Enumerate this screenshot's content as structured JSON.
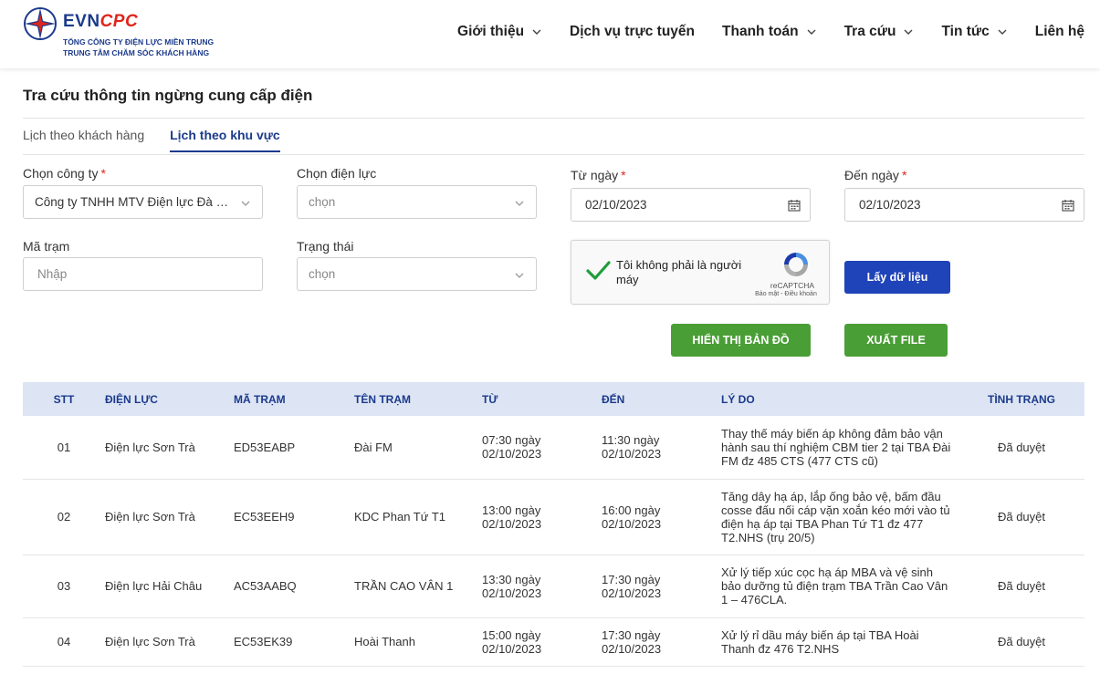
{
  "header": {
    "brand_evn": "EVN",
    "brand_cpc": "CPC",
    "line1": "TỔNG CÔNG TY ĐIỆN LỰC MIỀN TRUNG",
    "line2": "TRUNG TÂM CHĂM SÓC KHÁCH HÀNG",
    "nav": [
      {
        "label": "Giới thiệu",
        "has_dropdown": true
      },
      {
        "label": "Dịch vụ trực tuyến",
        "has_dropdown": false
      },
      {
        "label": "Thanh toán",
        "has_dropdown": true
      },
      {
        "label": "Tra cứu",
        "has_dropdown": true
      },
      {
        "label": "Tin tức",
        "has_dropdown": true
      },
      {
        "label": "Liên hệ",
        "has_dropdown": false
      }
    ]
  },
  "page": {
    "title": "Tra cứu thông tin ngừng cung cấp điện",
    "tabs": [
      {
        "label": "Lịch theo khách hàng",
        "active": false
      },
      {
        "label": "Lịch theo khu vực",
        "active": true
      }
    ]
  },
  "form": {
    "company_label": "Chọn công ty",
    "company_value": "Công ty TNHH MTV Điện lực Đà Nẵng",
    "power_label": "Chọn điện lực",
    "power_placeholder": "chọn",
    "from_label": "Từ ngày",
    "from_value": "02/10/2023",
    "to_label": "Đến ngày",
    "to_value": "02/10/2023",
    "station_label": "Mã trạm",
    "station_placeholder": "Nhập",
    "status_label": "Trạng thái",
    "status_placeholder": "chọn",
    "required_mark": "*"
  },
  "captcha": {
    "text": "Tôi không phải là người máy",
    "brand": "reCAPTCHA",
    "links": "Bảo mật - Điều khoản"
  },
  "buttons": {
    "fetch": "Lấy dữ liệu",
    "map": "HIỂN THỊ BẢN ĐỒ",
    "export": "XUẤT FILE"
  },
  "colors": {
    "primary": "#1b3a8c",
    "button_blue": "#1f43b8",
    "button_green": "#4a9e36",
    "required": "#e0241b",
    "table_header_bg": "#dde5f4"
  },
  "table": {
    "headers": [
      "STT",
      "ĐIỆN LỰC",
      "MÃ TRẠM",
      "TÊN TRẠM",
      "TỪ",
      "ĐẾN",
      "LÝ DO",
      "TÌNH TRẠNG"
    ],
    "rows": [
      {
        "stt": "01",
        "dien_luc": "Điện lực Sơn Trà",
        "ma_tram": "ED53EABP",
        "ten_tram": "Đài FM",
        "tu": "07:30 ngày 02/10/2023",
        "den": "11:30 ngày 02/10/2023",
        "ly_do": "Thay thế máy biến áp không đảm bảo vận hành sau thí nghiệm CBM tier 2 tại TBA Đài FM đz 485 CTS (477 CTS cũ)",
        "tinh_trang": "Đã duyệt"
      },
      {
        "stt": "02",
        "dien_luc": "Điện lực Sơn Trà",
        "ma_tram": "EC53EEH9",
        "ten_tram": "KDC Phan Tứ T1",
        "tu": "13:00 ngày 02/10/2023",
        "den": "16:00 ngày 02/10/2023",
        "ly_do": "Tăng dây hạ áp, lắp ống bảo vệ, bấm đầu cosse đấu nối cáp vặn xoắn kéo mới vào tủ điện hạ áp tại TBA Phan Tứ T1 đz 477 T2.NHS (trụ 20/5)",
        "tinh_trang": "Đã duyệt"
      },
      {
        "stt": "03",
        "dien_luc": "Điện lực Hải Châu",
        "ma_tram": "AC53AABQ",
        "ten_tram": "TRẦN CAO VÂN 1",
        "tu": "13:30 ngày 02/10/2023",
        "den": "17:30 ngày 02/10/2023",
        "ly_do": "Xử lý tiếp xúc cọc hạ áp MBA và vệ sinh bảo dưỡng tủ điện trạm TBA Trần Cao Vân 1 – 476CLA.",
        "tinh_trang": "Đã duyệt"
      },
      {
        "stt": "04",
        "dien_luc": "Điện lực Sơn Trà",
        "ma_tram": "EC53EK39",
        "ten_tram": "Hoài Thanh",
        "tu": "15:00 ngày 02/10/2023",
        "den": "17:30 ngày 02/10/2023",
        "ly_do": "Xử lý rỉ dầu máy biến áp tại TBA Hoài Thanh đz 476 T2.NHS",
        "tinh_trang": "Đã duyệt"
      }
    ]
  }
}
